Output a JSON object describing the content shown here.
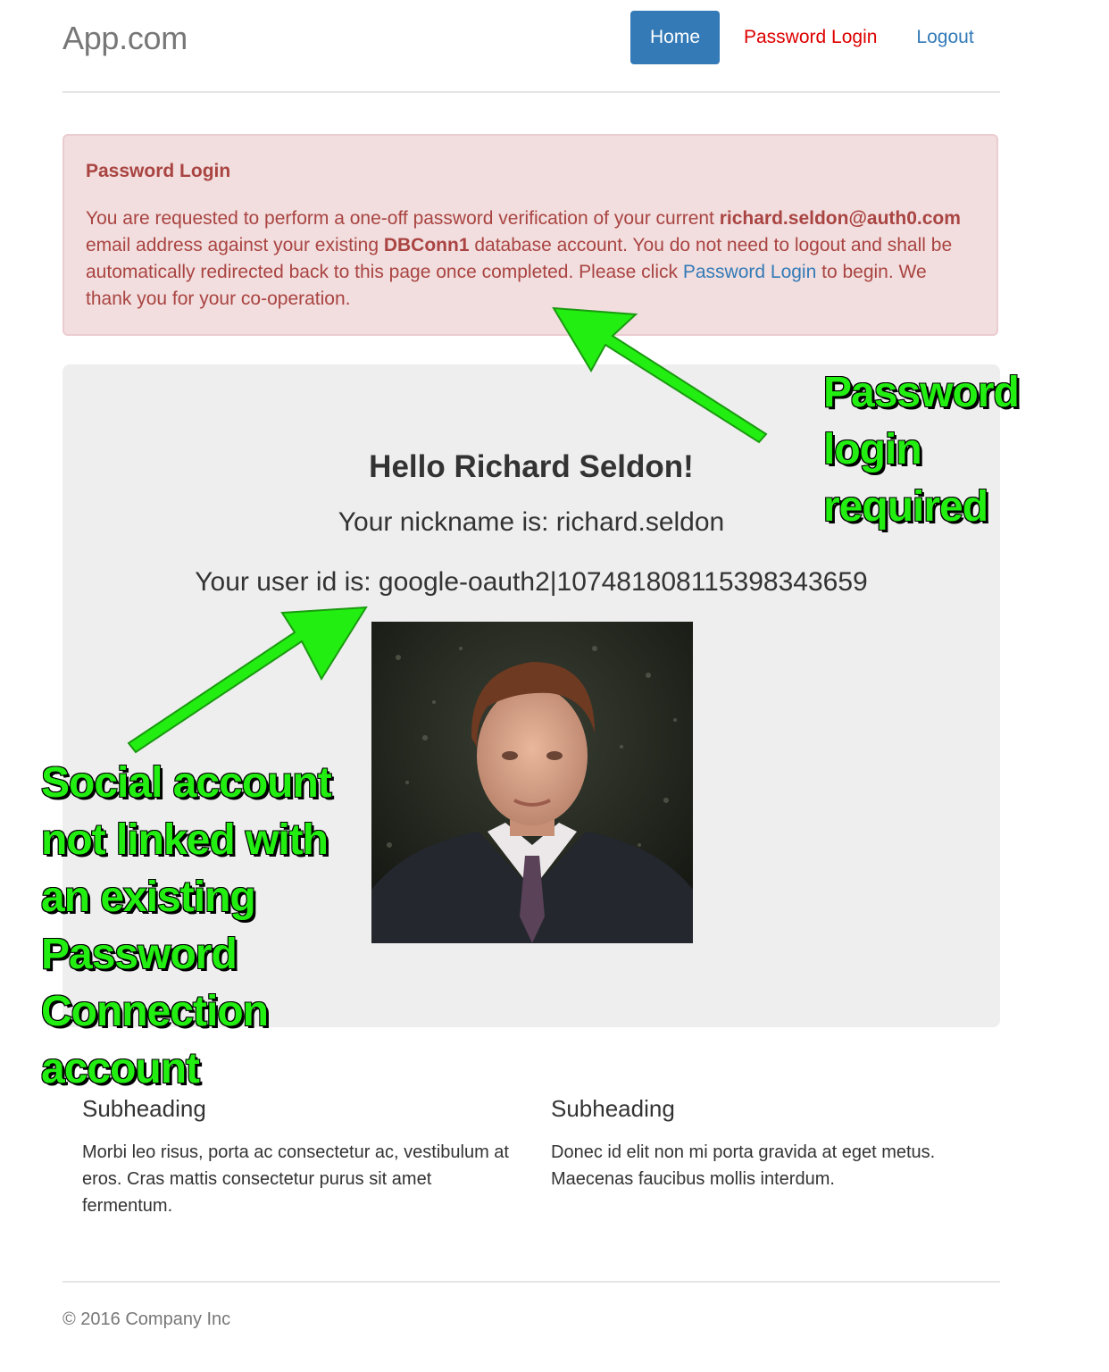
{
  "brand": "App.com",
  "nav": {
    "home": "Home",
    "password_login": "Password Login",
    "logout": "Logout"
  },
  "alert": {
    "heading": "Password Login",
    "text1": "You are requested to perform a one-off password verification of your current ",
    "email": "richard.seldon@auth0.com",
    "text2": " email address against your existing ",
    "db": "DBConn1",
    "text3": " database account. You do not need to logout and shall be automatically redirected back to this page once completed. Please click ",
    "link": "Password Login",
    "text4": " to begin. We thank you for your co-operation."
  },
  "jumbotron": {
    "greeting": "Hello Richard Seldon!",
    "nickname": "Your nickname is: richard.seldon",
    "user_id": "Your user id is: google-oauth2|107481808115398343659"
  },
  "columns": [
    {
      "heading": "Subheading",
      "text": "Morbi leo risus, porta ac consectetur ac, vestibulum at eros. Cras mattis consectetur purus sit amet fermentum."
    },
    {
      "heading": "Subheading",
      "text": "Donec id elit non mi porta gravida at eget metus. Maecenas faucibus mollis interdum."
    }
  ],
  "footer": "© 2016 Company Inc",
  "annotations": {
    "right": [
      "Password",
      "login",
      "required"
    ],
    "left": [
      "Social account",
      "not linked with",
      "an existing",
      "Password",
      "Connection",
      "account"
    ]
  },
  "colors": {
    "primary": "#337ab7",
    "danger_text": "#a94442",
    "danger_bg": "#f2dede",
    "annotation": "#22ee11"
  }
}
